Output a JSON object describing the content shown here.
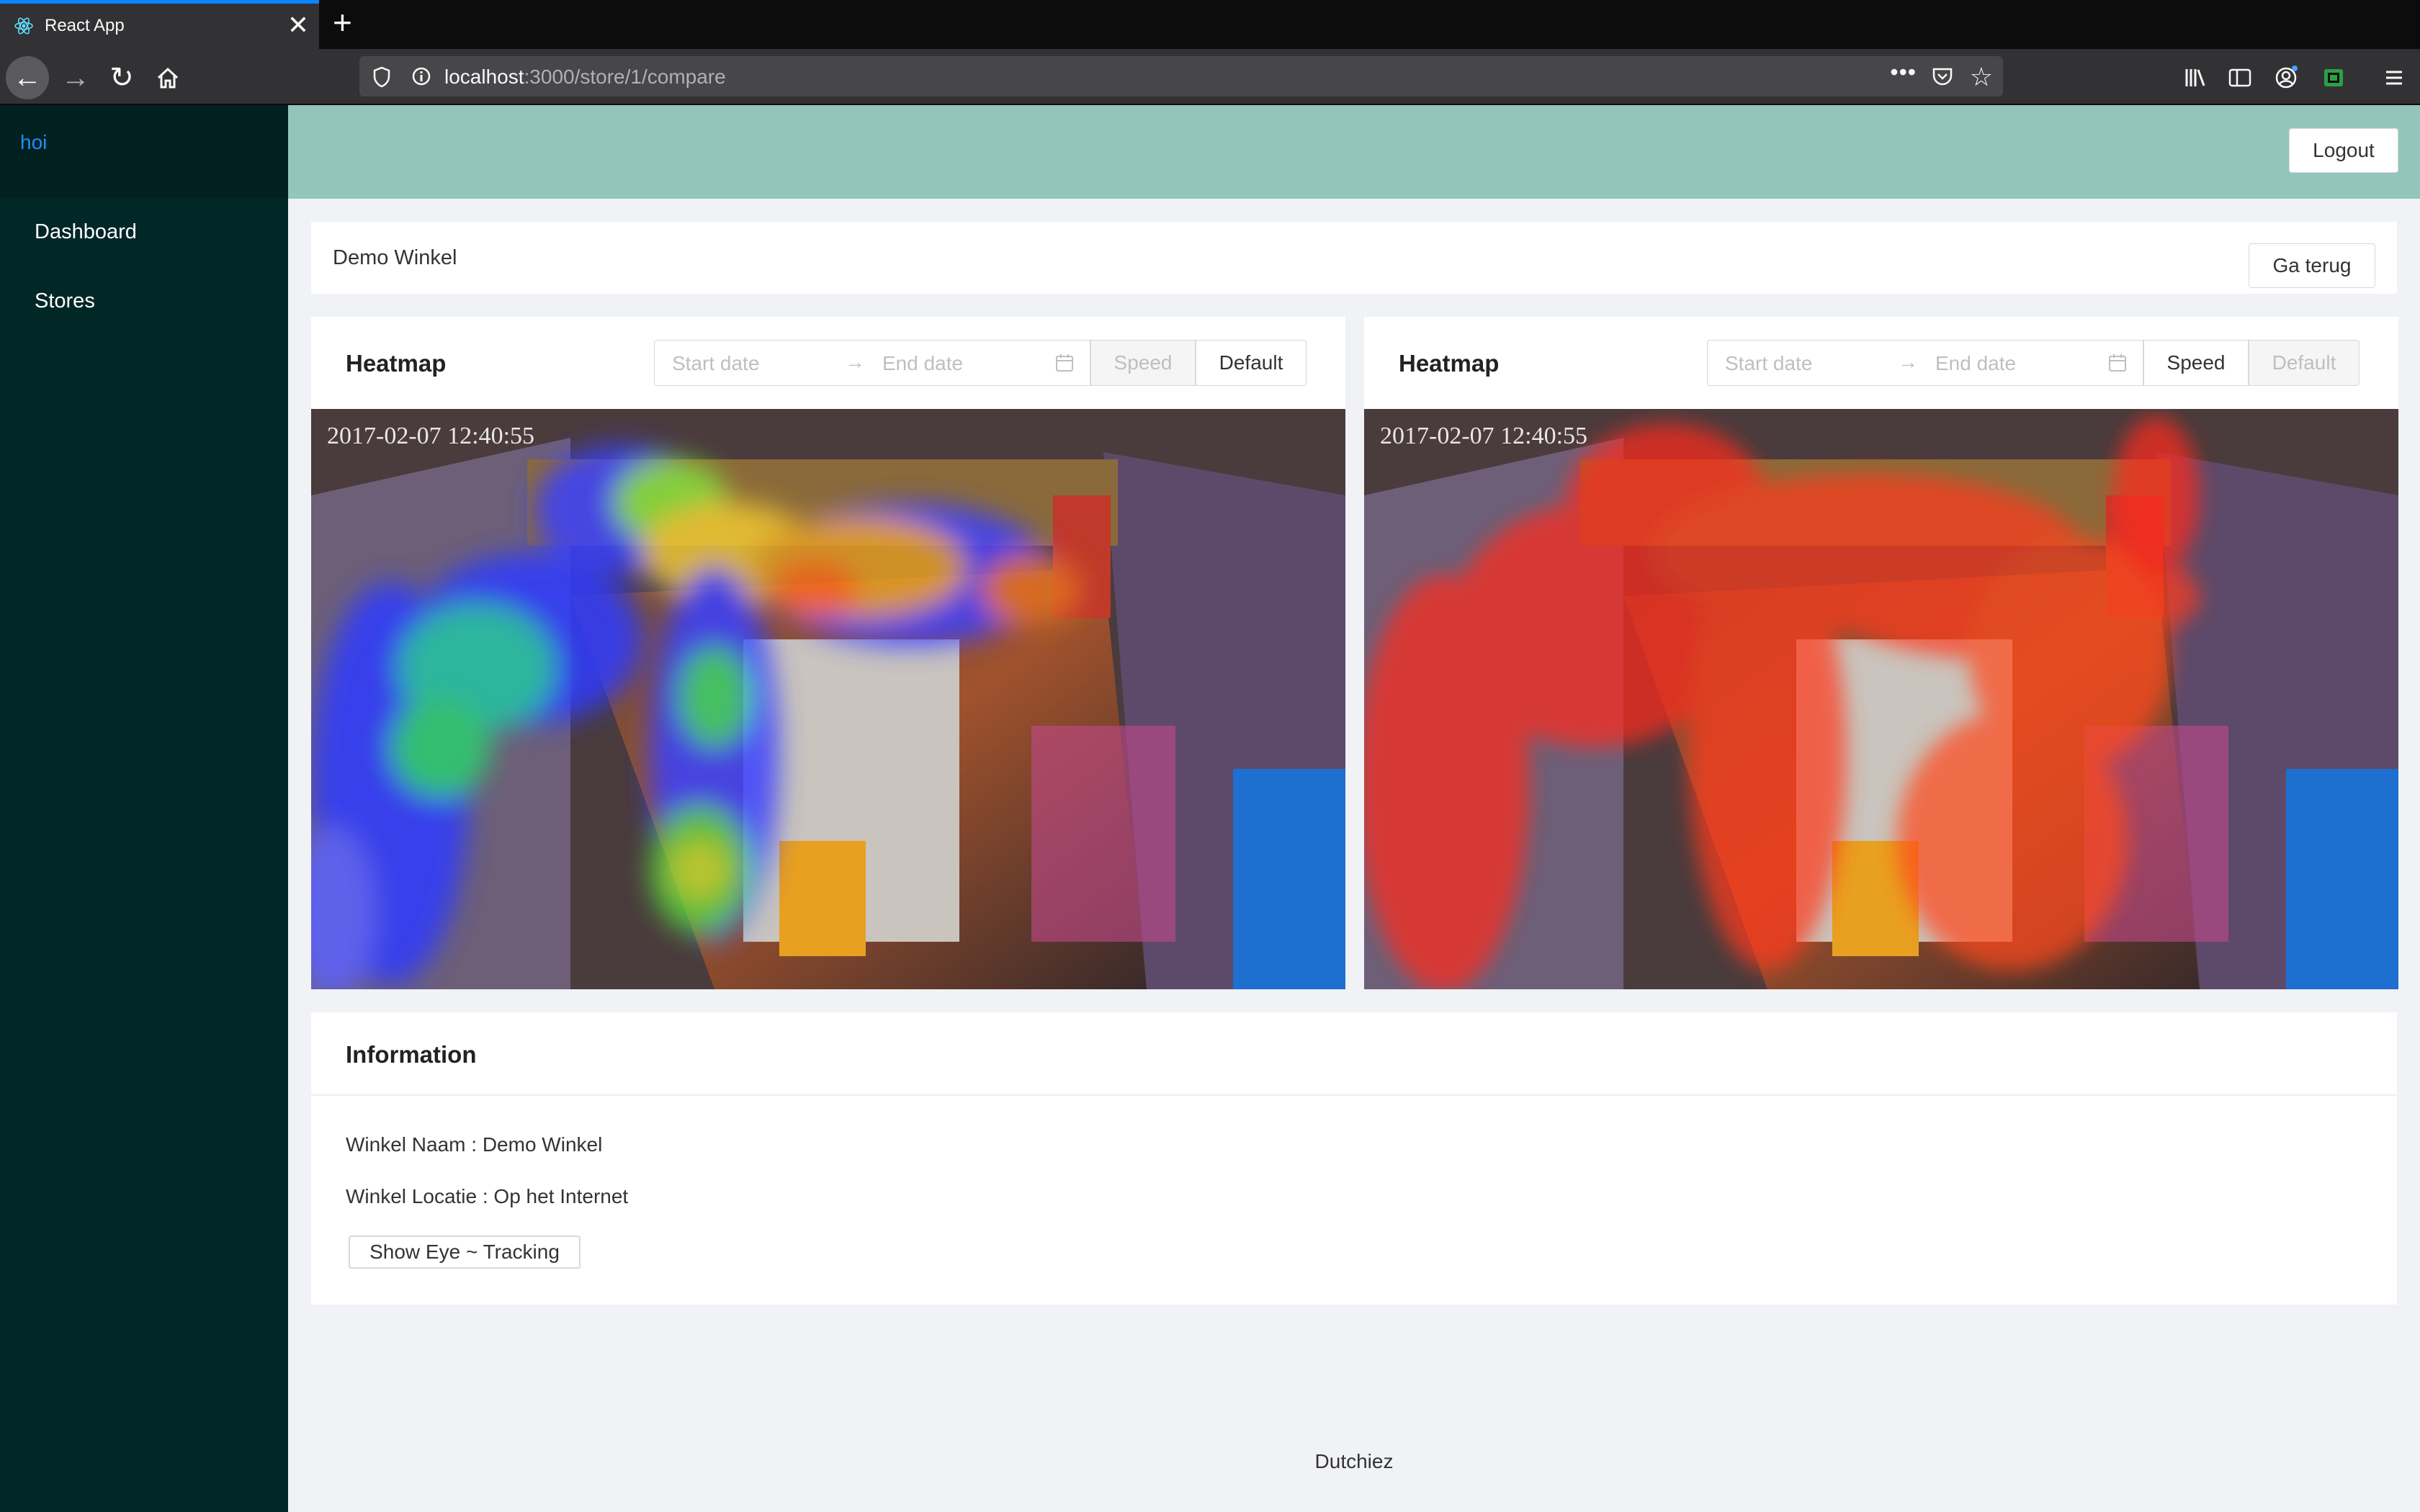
{
  "browser": {
    "tab_title": "React App",
    "url_host": "localhost",
    "url_path": ":3000/store/1/compare",
    "page_actions": "•••"
  },
  "sidebar": {
    "brand": "hoi",
    "items": [
      {
        "label": "Dashboard"
      },
      {
        "label": "Stores"
      }
    ]
  },
  "header": {
    "logout_label": "Logout"
  },
  "store": {
    "name": "Demo Winkel",
    "back_label": "Ga terug"
  },
  "heatmaps": [
    {
      "title": "Heatmap",
      "start_placeholder": "Start date",
      "end_placeholder": "End date",
      "speed_label": "Speed",
      "default_label": "Default",
      "active_mode": "Default",
      "timestamp": "2017-02-07 12:40:55"
    },
    {
      "title": "Heatmap",
      "start_placeholder": "Start date",
      "end_placeholder": "End date",
      "speed_label": "Speed",
      "default_label": "Default",
      "active_mode": "Speed",
      "timestamp": "2017-02-07 12:40:55"
    }
  ],
  "information": {
    "title": "Information",
    "winkel_naam": "Winkel Naam : Demo Winkel",
    "winkel_locatie": "Winkel Locatie : Op het Internet",
    "eye_tracking_label": "Show Eye ~ Tracking"
  },
  "footer": {
    "text": "Dutchiez"
  },
  "colors": {
    "accent": "#1890ff",
    "sidebar_bg": "#022727",
    "header_bg": "#93c5bc",
    "page_bg": "#f0f2f5"
  }
}
